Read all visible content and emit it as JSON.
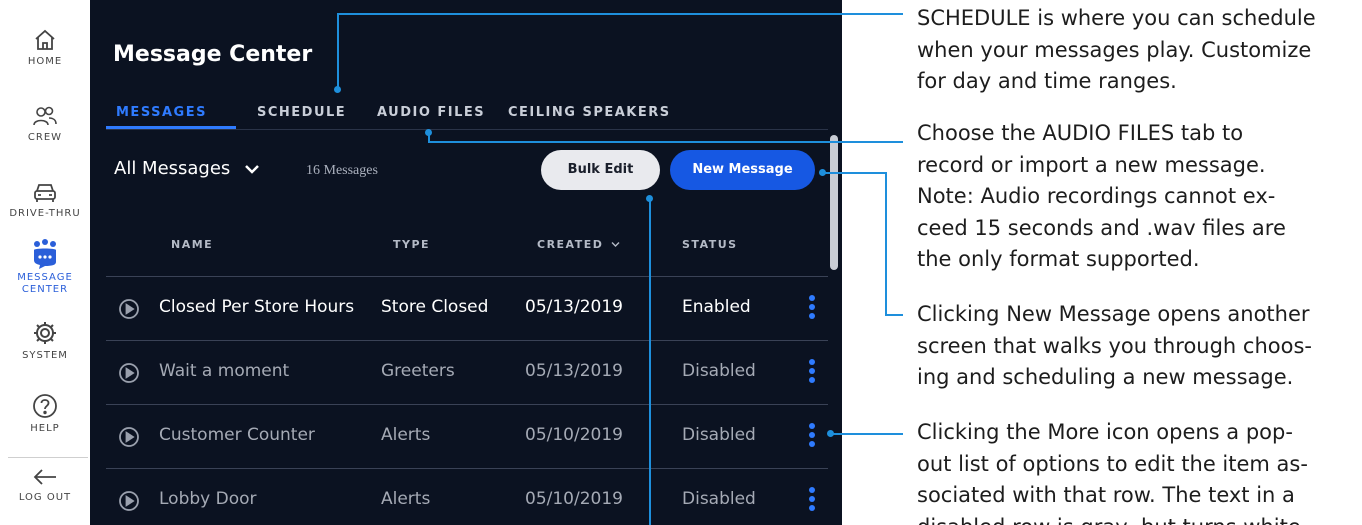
{
  "nav": {
    "home": "HOME",
    "crew": "CREW",
    "drive_thru": "DRIVE-THRU",
    "message_center_1": "MESSAGE",
    "message_center_2": "CENTER",
    "system": "SYSTEM",
    "help": "HELP",
    "logout": "LOG OUT"
  },
  "app": {
    "title": "Message Center",
    "tabs": [
      "MESSAGES",
      "SCHEDULE",
      "AUDIO FILES",
      "CEILING SPEAKERS"
    ],
    "filter_label": "All Messages",
    "message_count": "16 Messages",
    "bulk_edit_label": "Bulk Edit",
    "new_message_label": "New Message"
  },
  "table": {
    "columns": [
      "NAME",
      "TYPE",
      "CREATED",
      "STATUS"
    ],
    "rows": [
      {
        "name": "Closed Per Store Hours",
        "type": "Store Closed",
        "created": "05/13/2019",
        "status": "Enabled"
      },
      {
        "name": "Wait a moment",
        "type": "Greeters",
        "created": "05/13/2019",
        "status": "Disabled"
      },
      {
        "name": "Customer Counter",
        "type": "Alerts",
        "created": "05/10/2019",
        "status": "Disabled"
      },
      {
        "name": "Lobby Door",
        "type": "Alerts",
        "created": "05/10/2019",
        "status": "Disabled"
      }
    ]
  },
  "annotations": {
    "schedule": {
      "l1": "SCHEDULE is where you can schedule",
      "l2": "when your messages play. Customize",
      "l3": "for day and time ranges."
    },
    "audio": {
      "l1": "Choose the AUDIO FILES tab to",
      "l2": "record or import a new message.",
      "l3_bold": "Note",
      "l3_rest": ": Audio recordings cannot ex-",
      "l4": "ceed 15 seconds and .wav files are",
      "l5": "the only format supported."
    },
    "new_message": {
      "l1": "Clicking New Message opens another",
      "l2": "screen that walks you through choos-",
      "l3": "ing and scheduling a new message."
    },
    "more": {
      "l1": "Clicking the More icon opens a pop-",
      "l2": "out list of options to edit the item as-",
      "l3": "sociated with that row. The text in a",
      "l4": "disabled row is gray, but turns white"
    }
  },
  "colors": {
    "panel_bg": "#0b1221",
    "accent_blue": "#2f7bff",
    "new_message_button": "#1658e3",
    "callout_line": "#1e8fdc"
  },
  "icons": [
    "home-icon",
    "crew-icon",
    "drive-thru-icon",
    "message-center-icon",
    "system-gear-icon",
    "help-icon",
    "logout-arrow-icon",
    "chevron-down-icon",
    "play-icon",
    "more-icon"
  ]
}
